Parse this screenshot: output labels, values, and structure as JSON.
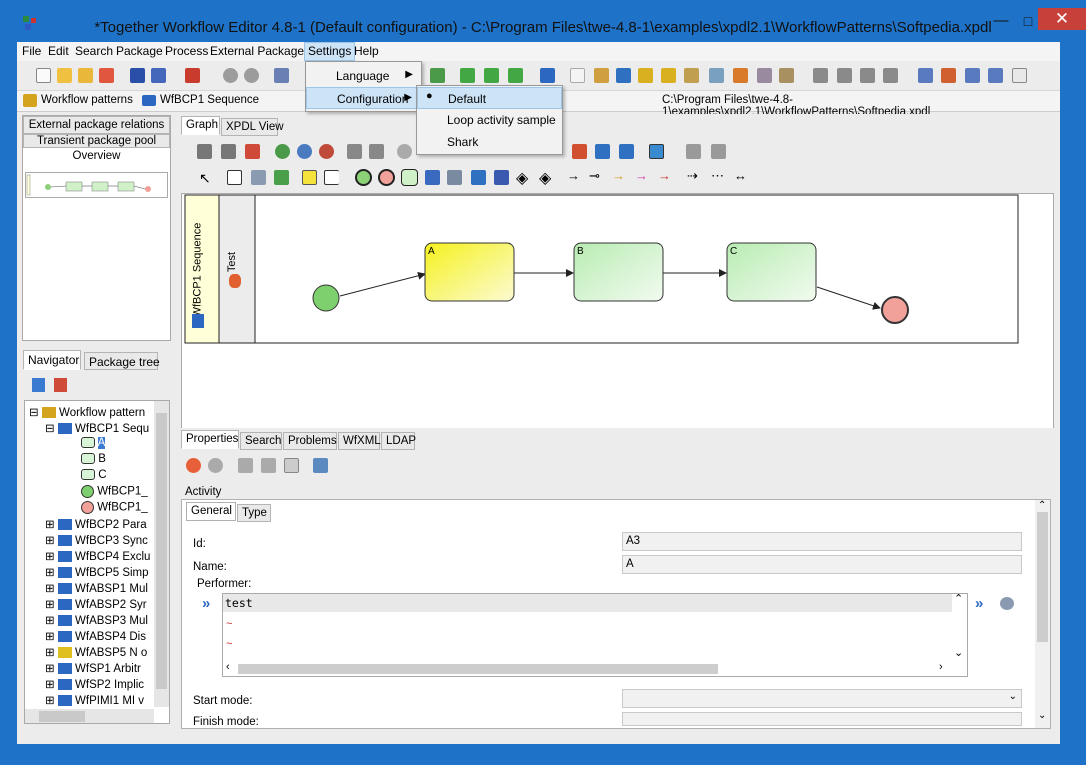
{
  "window": {
    "title": "*Together Workflow Editor 4.8-1 (Default configuration) - C:\\Program Files\\twe-4.8-1\\examples\\xpdl2.1\\WorkflowPatterns\\Softpedia.xpdl",
    "minimize": "—",
    "maximize": "□",
    "close": "✕"
  },
  "menubar": [
    "File",
    "Edit",
    "Search",
    "Package",
    "Process",
    "External Packages",
    "Settings",
    "Help"
  ],
  "addressbar": {
    "package": "Workflow patterns",
    "process": "WfBCP1 Sequence",
    "path": "C:\\Program Files\\twe-4.8-1\\examples\\xpdl2.1\\WorkflowPatterns\\Softpedia.xpdl"
  },
  "left_top": {
    "tab1": "External package relations",
    "tab2": "Transient package pool",
    "tab3": "Overview"
  },
  "navigator": {
    "tab1": "Navigator",
    "tab2": "Package tree",
    "root": "Workflow pattern",
    "items": [
      {
        "label": "WfBCP1 Sequ",
        "expanded": true
      },
      {
        "label": "A"
      },
      {
        "label": "B"
      },
      {
        "label": "C"
      },
      {
        "label": "WfBCP1_"
      },
      {
        "label": "WfBCP1_"
      },
      {
        "label": "WfBCP2 Para"
      },
      {
        "label": "WfBCP3 Sync"
      },
      {
        "label": "WfBCP4 Exclu"
      },
      {
        "label": "WfBCP5 Simp"
      },
      {
        "label": "WfABSP1 Mul"
      },
      {
        "label": "WfABSP2 Syr"
      },
      {
        "label": "WfABSP3 Mul"
      },
      {
        "label": "WfABSP4 Dis"
      },
      {
        "label": "WfABSP5 N o"
      },
      {
        "label": "WfSP1 Arbitr"
      },
      {
        "label": "WfSP2 Implic"
      },
      {
        "label": "WfPIMI1 MI v"
      }
    ]
  },
  "graph": {
    "tab1": "Graph",
    "tab2": "XPDL View",
    "pool_label": "WfBCP1 Sequence",
    "lane_label": "Test",
    "activities": [
      "A",
      "B",
      "C"
    ]
  },
  "properties": {
    "tabs": [
      "Properties",
      "Search",
      "Problems",
      "WfXML",
      "LDAP"
    ],
    "section": "Activity",
    "subtabs": [
      "General",
      "Type"
    ],
    "id_label": "Id:",
    "id_value": "A3",
    "name_label": "Name:",
    "name_value": "A",
    "performer_label": "Performer:",
    "performer_value": "test",
    "start_mode_label": "Start mode:",
    "finish_mode_label": "Finish mode:"
  },
  "settings_menu": {
    "language": "Language",
    "configuration": "Configuration"
  },
  "config_submenu": {
    "items": [
      "Default",
      "Loop activity sample",
      "Shark"
    ],
    "selected": "Default"
  },
  "colors": {
    "accent": "#1e73c8",
    "activity_yellow": "#f5f11e",
    "activity_green": "#c8f0c8",
    "start_green": "#7ed06e",
    "end_red": "#f2a09a"
  }
}
